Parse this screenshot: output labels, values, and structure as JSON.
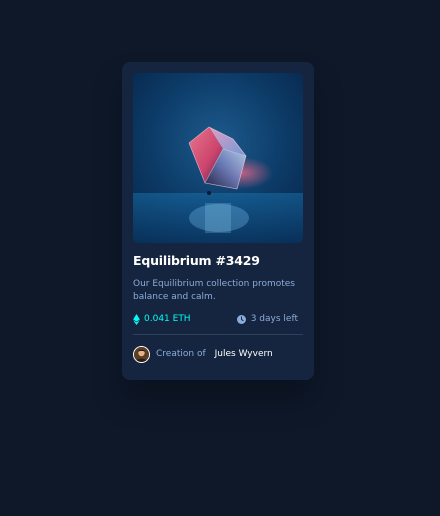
{
  "card": {
    "image_alt": "Equilibrium",
    "title": "Equilibrium #3429",
    "description": "Our Equilibrium collection promotes balance and calm.",
    "price": "0.041 ETH",
    "time_left": "3 days left",
    "creator_prefix": "Creation of",
    "creator_name": "Jules Wyvern"
  },
  "colors": {
    "background": "#0e1829",
    "card": "#15253f",
    "accent_cyan": "#00fff8",
    "soft_blue": "#8bacd9",
    "divider": "#2e405a",
    "white": "#ffffff"
  },
  "icons": {
    "price": "ethereum-icon",
    "time": "clock-icon"
  }
}
